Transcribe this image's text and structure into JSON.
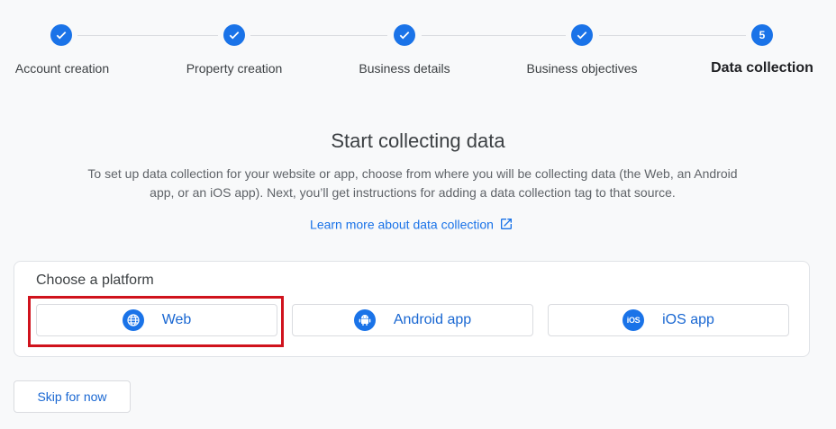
{
  "stepper": {
    "steps": [
      {
        "label": "Account creation",
        "state": "completed"
      },
      {
        "label": "Property creation",
        "state": "completed"
      },
      {
        "label": "Business details",
        "state": "completed"
      },
      {
        "label": "Business objectives",
        "state": "completed"
      },
      {
        "label": "Data collection",
        "state": "current",
        "number": "5"
      }
    ]
  },
  "main": {
    "title": "Start collecting data",
    "description_line1": "To set up data collection for your website or app, choose from where you will be collecting data (the Web, an Android",
    "description_line2": "app, or an iOS app). Next, you’ll get instructions for adding a data collection tag to that source.",
    "learn_more": "Learn more about data collection"
  },
  "platform_card": {
    "title": "Choose a platform",
    "options": [
      {
        "label": "Web",
        "icon": "globe-icon"
      },
      {
        "label": "Android app",
        "icon": "android-icon"
      },
      {
        "label": "iOS app",
        "icon": "ios-icon",
        "icon_text": "iOS"
      }
    ]
  },
  "footer": {
    "skip_label": "Skip for now"
  },
  "colors": {
    "accent": "#1a73e8",
    "link": "#1967d2",
    "highlight": "#d0131d",
    "background": "#f8f9fa"
  }
}
